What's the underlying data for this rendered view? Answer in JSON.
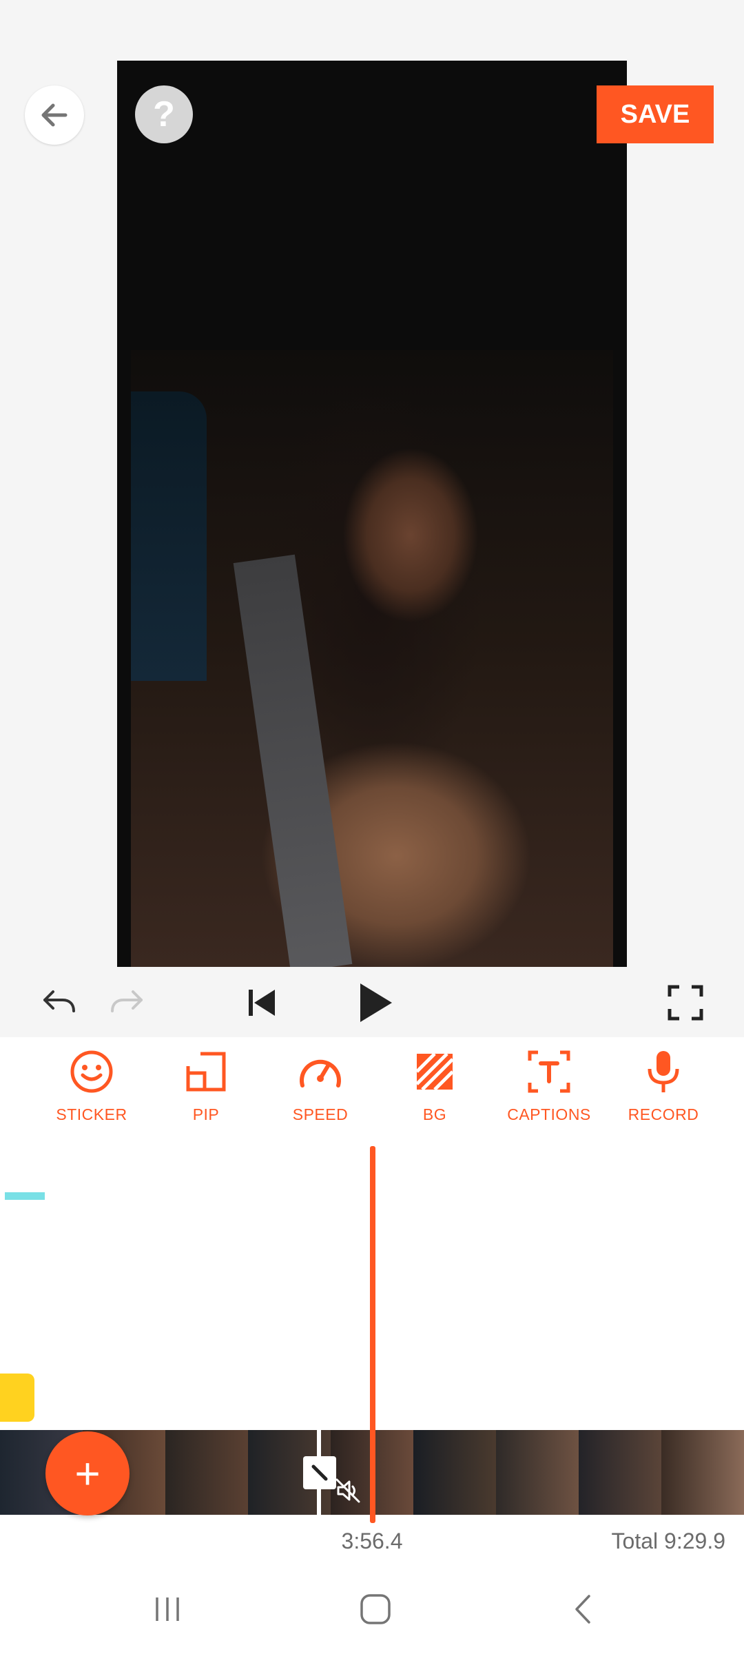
{
  "header": {
    "back_icon": "arrow-left-icon",
    "help_icon": "question-icon",
    "help_label": "?",
    "save_label": "SAVE",
    "accent": "#FF5722"
  },
  "playback": {
    "undo_icon": "undo-icon",
    "redo_icon": "redo-icon",
    "skip_start_icon": "skip-start-icon",
    "play_icon": "play-icon",
    "fullscreen_icon": "fullscreen-icon"
  },
  "tools": [
    {
      "label": "STICKER",
      "icon": "sticker-icon"
    },
    {
      "label": "PIP",
      "icon": "pip-icon"
    },
    {
      "label": "SPEED",
      "icon": "speedometer-icon"
    },
    {
      "label": "BG",
      "icon": "background-icon"
    },
    {
      "label": "CAPTIONS",
      "icon": "captions-icon"
    },
    {
      "label": "RECORD",
      "icon": "microphone-icon"
    }
  ],
  "timeline": {
    "add_label": "+",
    "current_time": "3:56.4",
    "total_time": "Total 9:29.9",
    "track_colors": {
      "text": "#79E0E6",
      "sticker": "#FFD21F"
    }
  },
  "system_nav": {
    "recents_icon": "recents-icon",
    "home_icon": "home-icon",
    "back_icon": "back-chevron-icon"
  }
}
